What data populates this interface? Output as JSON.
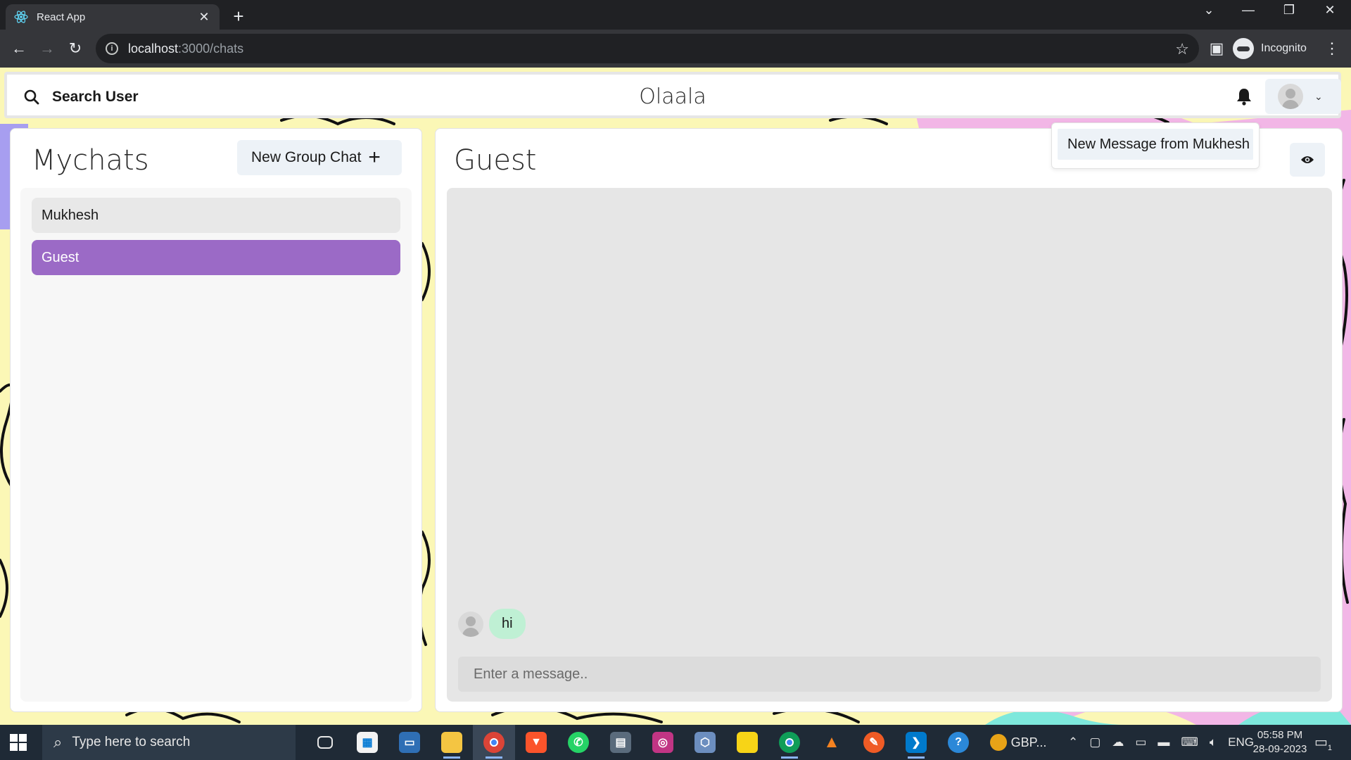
{
  "browser": {
    "tab_title": "React App",
    "url_host": "localhost",
    "url_path": ":3000/chats",
    "profile_label": "Incognito"
  },
  "header": {
    "search_label": "Search User",
    "brand": "Olaala"
  },
  "notification": {
    "text": "New Message from Mukhesh"
  },
  "mychats": {
    "title": "Mychats",
    "new_group_label": "New Group Chat",
    "chats": [
      {
        "name": "Mukhesh",
        "active": false
      },
      {
        "name": "Guest",
        "active": true
      }
    ]
  },
  "chat": {
    "title": "Guest",
    "messages": [
      {
        "text": "hi"
      }
    ],
    "input_placeholder": "Enter a message.."
  },
  "taskbar": {
    "search_placeholder": "Type here to search",
    "pinned_label": "GBP...",
    "language": "ENG",
    "time": "05:58 PM",
    "date": "28-09-2023",
    "notification_count": "1"
  },
  "colors": {
    "active_chat": "#9b6ac6",
    "message_bubble": "#bff0d4",
    "page_background": "#fbf7b6"
  }
}
